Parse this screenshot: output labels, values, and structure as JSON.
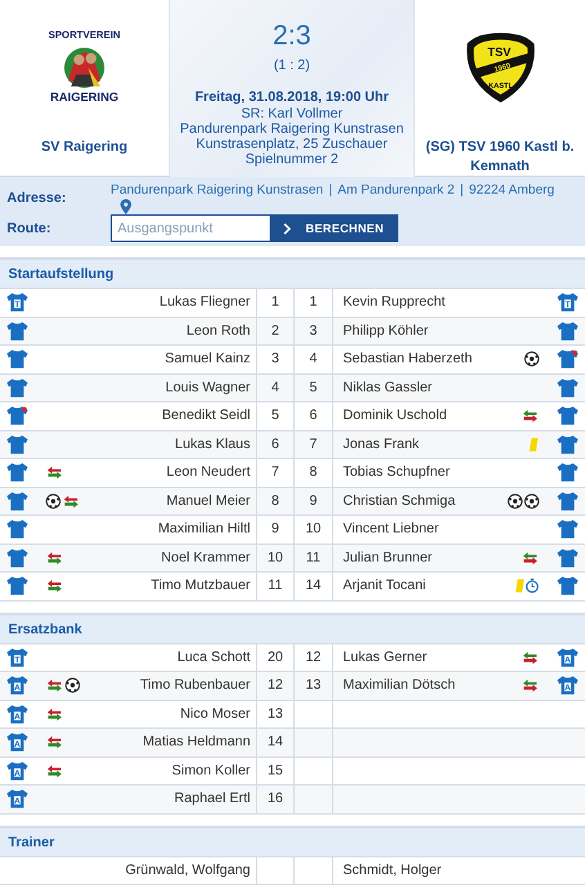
{
  "match": {
    "home": {
      "name": "SV Raigering",
      "logo_top": "SPORTVEREIN",
      "logo_bottom": "RAIGERING"
    },
    "away": {
      "name": "(SG) TSV 1960 Kastl b. Kemnath",
      "logo_top": "TSV",
      "logo_year": "1960",
      "logo_bottom": "KASTL"
    },
    "score": "2:3",
    "halftime": "(1 : 2)",
    "date": "Freitag, 31.08.2018, 19:00 Uhr",
    "details": [
      "SR: Karl Vollmer",
      "Pandurenpark Raigering Kunstrasen",
      "Kunstrasenplatz, 25 Zuschauer",
      "Spielnummer 2"
    ]
  },
  "venue": {
    "address_label": "Adresse:",
    "address_parts": [
      "Pandurenpark Raigering Kunstrasen",
      "Am Pandurenpark 2",
      "92224 Amberg"
    ],
    "separator": "|",
    "route_label": "Route:",
    "placeholder": "Ausgangspunkt",
    "button": "BERECHNEN"
  },
  "sections": [
    {
      "title": "Startaufstellung",
      "rows": [
        {
          "home": {
            "name": "Lukas Fliegner",
            "number": "1",
            "letter": "T",
            "captain": false
          },
          "away": {
            "name": "Kevin Rupprecht",
            "number": "1",
            "letter": "T",
            "captain": false
          }
        },
        {
          "home": {
            "name": "Leon Roth",
            "number": "2",
            "captain": false
          },
          "away": {
            "name": "Philipp Köhler",
            "number": "3",
            "captain": false
          }
        },
        {
          "home": {
            "name": "Samuel Kainz",
            "number": "3",
            "captain": false
          },
          "away": {
            "name": "Sebastian Haberzeth",
            "number": "4",
            "captain": true,
            "events": [
              {
                "kind": "goal"
              }
            ]
          }
        },
        {
          "home": {
            "name": "Louis Wagner",
            "number": "4",
            "captain": false
          },
          "away": {
            "name": "Niklas Gassler",
            "number": "5",
            "captain": false
          }
        },
        {
          "home": {
            "name": "Benedikt Seidl",
            "number": "5",
            "captain": true
          },
          "away": {
            "name": "Dominik Uschold",
            "number": "6",
            "captain": false,
            "events": [
              {
                "kind": "substitution"
              }
            ]
          }
        },
        {
          "home": {
            "name": "Lukas Klaus",
            "number": "6",
            "captain": false
          },
          "away": {
            "name": "Jonas Frank",
            "number": "7",
            "captain": false,
            "events": [
              {
                "kind": "yellow_card"
              }
            ]
          }
        },
        {
          "home": {
            "name": "Leon Neudert",
            "number": "7",
            "captain": false,
            "events": [
              {
                "kind": "substitution"
              }
            ]
          },
          "away": {
            "name": "Tobias Schupfner",
            "number": "8",
            "captain": false
          }
        },
        {
          "home": {
            "name": "Manuel Meier",
            "number": "8",
            "captain": false,
            "events": [
              {
                "kind": "goal"
              },
              {
                "kind": "substitution"
              }
            ]
          },
          "away": {
            "name": "Christian Schmiga",
            "number": "9",
            "captain": false,
            "events": [
              {
                "kind": "goal"
              },
              {
                "kind": "goal"
              }
            ]
          }
        },
        {
          "home": {
            "name": "Maximilian Hiltl",
            "number": "9",
            "captain": false
          },
          "away": {
            "name": "Vincent Liebner",
            "number": "10",
            "captain": false
          }
        },
        {
          "home": {
            "name": "Noel Krammer",
            "number": "10",
            "captain": false,
            "events": [
              {
                "kind": "substitution"
              }
            ]
          },
          "away": {
            "name": "Julian Brunner",
            "number": "11",
            "captain": false,
            "events": [
              {
                "kind": "substitution"
              }
            ]
          }
        },
        {
          "home": {
            "name": "Timo Mutzbauer",
            "number": "11",
            "captain": false,
            "events": [
              {
                "kind": "substitution"
              }
            ]
          },
          "away": {
            "name": "Arjanit Tocani",
            "number": "14",
            "captain": false,
            "events": [
              {
                "kind": "yellow_card"
              },
              {
                "kind": "timer"
              }
            ]
          }
        }
      ]
    },
    {
      "title": "Ersatzbank",
      "rows": [
        {
          "home": {
            "name": "Luca Schott",
            "number": "20",
            "letter": "T",
            "captain": false
          },
          "away": {
            "name": "Lukas Gerner",
            "number": "12",
            "letter": "A",
            "captain": false,
            "events": [
              {
                "kind": "substitution"
              }
            ]
          }
        },
        {
          "home": {
            "name": "Timo Rubenbauer",
            "number": "12",
            "letter": "A",
            "captain": false,
            "events": [
              {
                "kind": "substitution"
              },
              {
                "kind": "goal"
              }
            ]
          },
          "away": {
            "name": "Maximilian Dötsch",
            "number": "13",
            "letter": "A",
            "captain": false,
            "events": [
              {
                "kind": "substitution"
              }
            ]
          }
        },
        {
          "home": {
            "name": "Nico Moser",
            "number": "13",
            "letter": "A",
            "captain": false,
            "events": [
              {
                "kind": "substitution"
              }
            ]
          }
        },
        {
          "home": {
            "name": "Matias Heldmann",
            "number": "14",
            "letter": "A",
            "captain": false,
            "events": [
              {
                "kind": "substitution"
              }
            ]
          }
        },
        {
          "home": {
            "name": "Simon Koller",
            "number": "15",
            "letter": "A",
            "captain": false,
            "events": [
              {
                "kind": "substitution"
              }
            ]
          }
        },
        {
          "home": {
            "name": "Raphael Ertl",
            "number": "16",
            "letter": "A",
            "captain": false
          }
        }
      ]
    },
    {
      "title": "Trainer",
      "rows": [
        {
          "home": {
            "name": "Grünwald, Wolfgang",
            "kind": "coach"
          },
          "away": {
            "name": "Schmidt, Holger",
            "kind": "coach"
          }
        }
      ]
    }
  ]
}
